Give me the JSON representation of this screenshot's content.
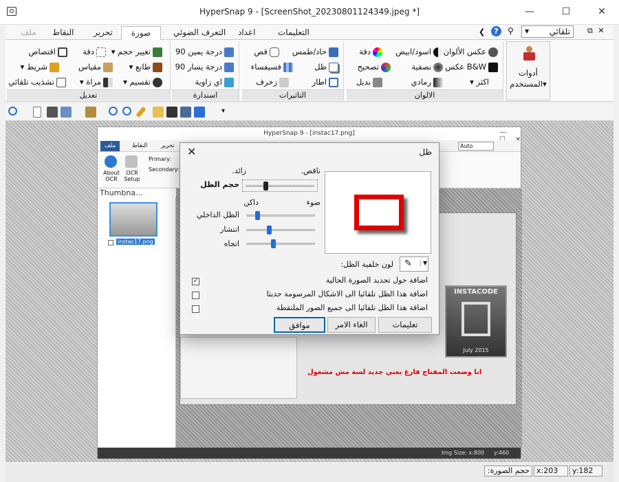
{
  "window": {
    "title": "HyperSnap 9 - [ScreenShot_20230801124349.jpeg *]",
    "min_glyph": "—",
    "max_glyph": "☐",
    "close_glyph": "✕"
  },
  "tabs": [
    "ملف",
    "النقاط",
    "تحرير",
    "صورة",
    "التعرف الضوئي",
    "اعداد",
    "التعليمات"
  ],
  "active_tab": "صورة",
  "right_controls": {
    "help_glyph": "?",
    "search_value": "تلقائي",
    "mdi_glyph": "⧉ ✕"
  },
  "ribbon": {
    "groups": {
      "edit": {
        "label": "تعديل",
        "items": [
          "تغيير حجم ▾",
          "دقة",
          "اقتصاص",
          "طابع ▾",
          "مقياس",
          "شريط ▾",
          "تقسيم ▾",
          "مراة ▾",
          "تشذيب تلقائي"
        ]
      },
      "rotate": {
        "label": "استدارة",
        "items": [
          "درجة يمين 90",
          "درجة يسار 90",
          "اي زاوية"
        ]
      },
      "effects": {
        "label": "التاثيرات",
        "items": [
          "حاد/طمس",
          "قص",
          "ظل",
          "فسيفساء",
          "اطار",
          "زخرف"
        ]
      },
      "colors": {
        "label": "الالوان",
        "items": [
          "عكس الألوان",
          "اسود/ابيض",
          "دقة",
          "B&W عكس",
          "نصفية",
          "تصحيح",
          "اكثر ▾",
          "رمادي",
          "بديل"
        ]
      },
      "user_tools": {
        "label_line1": "أدوات",
        "label_line2": "المستخدم▾"
      }
    }
  },
  "status": {
    "image_size": "حجم الصورة:",
    "x": "x:203",
    "y": "y:182"
  },
  "inner": {
    "title": "HyperSnap 9 - [instac17.png]",
    "tabs": [
      "ملف",
      "النقاط",
      "تحرير"
    ],
    "about_ocr": "About OCR",
    "ocr_setup": "OCR Setup",
    "primary": "Primary:",
    "secondary": "Secondary:",
    "zoom": "Auto",
    "thumbnails": "Thumbna...",
    "thumb_file": "instac17.png",
    "instacode": "INSTACODE",
    "instacode_date": "July 2015",
    "caption": "انا وضعت المفتاح فارغ يعني جديد لسة مش مشغول",
    "img_size": "Img Size:  x:800",
    "img_y": "y:460"
  },
  "dialog": {
    "title": "ظل",
    "close_glyph": "✕",
    "shadow_size_label": "حجم الظل",
    "less": "ناقص.",
    "more": "زائد.",
    "light": "ضوء",
    "dark": "داكن",
    "inner_shadow": "الظل الداخلي",
    "spread": "انتشار",
    "direction": "اتجاه",
    "bg_color": "لون خلفية الظل:",
    "checks": [
      {
        "label": "اضافة حول تحديد الصورة الحالية",
        "checked": true
      },
      {
        "label": "اضافة هذا الظل تلقائيا الى الاشكال المرسومة حديثا",
        "checked": false
      },
      {
        "label": "اضافة هذا الظل تلقائيا الى جميع الصور الملتقطة",
        "checked": false
      }
    ],
    "sliders": {
      "shadow_size": 0.25,
      "inner_shadow": 0.12,
      "spread": 0.3,
      "direction": 0.36
    },
    "buttons": {
      "help": "تعليمات",
      "cancel": "الغاء الامر",
      "ok": "موافق"
    },
    "preview_color": "#e00000"
  }
}
